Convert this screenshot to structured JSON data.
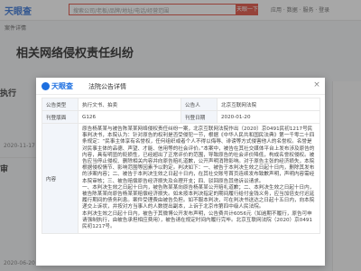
{
  "background": {
    "logo": "天眼查",
    "search_placeholder": "搜索公司/老板/品牌/地址/电话/经营范围",
    "search_button": "天眼一下",
    "top_nav": "应用 · 数据 · 服务 · 登录",
    "breadcrumb": "案件详情",
    "page_title": "相关网络侵权责任纠纷",
    "left_items": [
      {
        "label": "执行",
        "date": "2020-11-17"
      },
      {
        "label": "审",
        "date": "2020-06-20"
      }
    ]
  },
  "modal": {
    "brand": "天眼查",
    "title": "法院公告详情",
    "close_icon": "×",
    "rows": [
      {
        "label1": "公告类型",
        "value1": "执行文书、拍卖",
        "label2": "公告人",
        "value2": "北京互联网法院"
      },
      {
        "label1": "刊登版面",
        "value1": "G126",
        "label2": "刊登日期",
        "value2": "2020-01-20"
      }
    ],
    "content_label": "内容",
    "content_paragraphs": [
      "原告杨某某与被告陈某某网络侵权责任纠纷一案，北京互联网法院作出（2020）京0491民初1217号民事判决书，本院认为：针对原告的权利是否受侵犯一节，根据《中华人民共和国民法典》第一千零二十四条规定：“民事主体享有名誉权，任何组织或者个人不得以侮辱、诽谤等方式侵害他人的名誉权。名誉是对民事主体的品德、声望、才能、信用等的社会评价。”本案中，被告在其社交媒体平台上发布涉及原告的内容，具有明显的贬损性，已经超出了正常评价的范围，导致原告的社会评价降低，构成名誉权侵权。被告应当停止侵权、删除相关内容并向原告赔礼道歉，公开声明消除影响。对于原告主张的经济损失，本院根据侵权情节、影响范围等因素予以酌定。判决如下：一、被告于本判决生效之日起十日内，删除其发布的涉案内容；二、被告于本判决生效之日起十日内，在其社交账号首页连续发布致歉声明，声明内容需经本院审核；三、被告赔偿原告经济损失及合理开支；四、驳回原告其他诉讼请求。",
      "一、本判决生效之日起十日内，被告陈某某向原告杨某某公开赔礼道歉；二、本判决生效之日起十日内，被告陈某某向原告杨某某赔偿经济损失。如未按本判决指定的期间履行给付金钱义务，应当加倍支付迟延履行期间的债务利息。案件受理费由被告负担。如不服本判决，可在判决书送达之日起十五日内，向本院递交上诉状，并按对方当事人的人数提出副本，上诉于北京市第四中级人民法院。",
      "本判决生效之日起十日内，被告于其微博公开发布声明，公告费共计6056元（如逾期不履行，原告可申请强制执行，由被告承担相应费用），被告请在规定时间内履行完毕。北京互联网法院（2020）京0491民初1217号。"
    ]
  }
}
